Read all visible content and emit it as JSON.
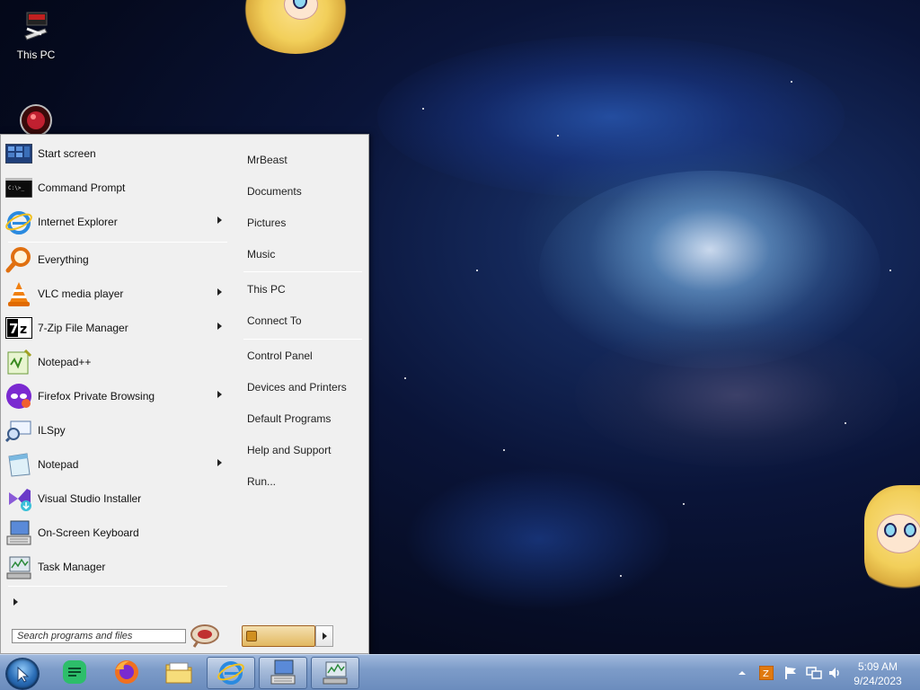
{
  "desktop": {
    "icons": [
      {
        "label": "This PC"
      },
      {
        "label": ""
      }
    ]
  },
  "start_menu": {
    "pinned": [
      {
        "label": "Start screen",
        "icon": "start-screen-icon",
        "has_submenu": false
      },
      {
        "label": "Command Prompt",
        "icon": "cmd-icon",
        "has_submenu": false
      },
      {
        "label": "Internet Explorer",
        "icon": "ie-icon",
        "has_submenu": true
      }
    ],
    "recent": [
      {
        "label": "Everything",
        "icon": "everything-icon",
        "has_submenu": false
      },
      {
        "label": "VLC media player",
        "icon": "vlc-icon",
        "has_submenu": true
      },
      {
        "label": "7-Zip File Manager",
        "icon": "7zip-icon",
        "has_submenu": true
      },
      {
        "label": "Notepad++",
        "icon": "notepadpp-icon",
        "has_submenu": false
      },
      {
        "label": "Firefox Private Browsing",
        "icon": "firefox-private-icon",
        "has_submenu": true
      },
      {
        "label": "ILSpy",
        "icon": "ilspy-icon",
        "has_submenu": false
      },
      {
        "label": "Notepad",
        "icon": "notepad-icon",
        "has_submenu": true
      },
      {
        "label": "Visual Studio Installer",
        "icon": "vs-installer-icon",
        "has_submenu": false
      },
      {
        "label": "On-Screen Keyboard",
        "icon": "keyboard-icon",
        "has_submenu": false
      },
      {
        "label": "Task Manager",
        "icon": "task-manager-icon",
        "has_submenu": false
      }
    ],
    "search_placeholder": "Search programs and files",
    "right_links_group1": [
      "MrBeast",
      "Documents",
      "Pictures",
      "Music"
    ],
    "right_links_group2": [
      "This PC",
      "Connect To"
    ],
    "right_links_group3": [
      "Control Panel",
      "Devices and Printers",
      "Default Programs",
      "Help and Support",
      "Run..."
    ]
  },
  "taskbar": {
    "pinned_apps": [
      {
        "name": "Google Chat",
        "icon": "chat-icon"
      },
      {
        "name": "Firefox",
        "icon": "firefox-icon"
      },
      {
        "name": "File Explorer",
        "icon": "folder-icon"
      },
      {
        "name": "Internet Explorer",
        "icon": "ie-icon"
      },
      {
        "name": "On-Screen Keyboard",
        "icon": "keyboard-icon"
      },
      {
        "name": "Task Manager",
        "icon": "task-manager-icon"
      }
    ],
    "clock": {
      "time": "5:09 AM",
      "date": "9/24/2023"
    }
  },
  "colors": {
    "taskbar": "#7d9cc9",
    "menu_bg": "#f0f0f0",
    "accent": "#2c6fb8"
  }
}
